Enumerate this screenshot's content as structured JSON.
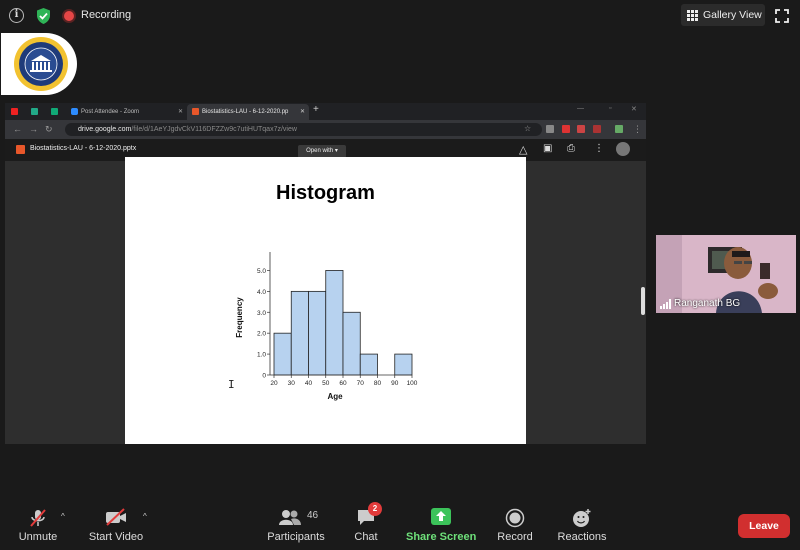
{
  "topbar": {
    "recording_label": "Recording",
    "gallery_view_label": "Gallery View"
  },
  "browser": {
    "tabs": [
      {
        "label": ""
      },
      {
        "label": ""
      },
      {
        "label": ""
      },
      {
        "label": "Post Attendee - Zoom"
      },
      {
        "label": "Biostatistics-LAU - 6-12-2020.pp"
      }
    ],
    "url_host": "drive.google.com",
    "url_rest": "/file/d/1AeYJgdvCkV116DFZZw9c7utiHUTqax7z/view",
    "file_title": "Biostatistics-LAU - 6-12-2020.pptx",
    "open_with_label": "Open with"
  },
  "slide": {
    "title": "Histogram"
  },
  "chart_data": {
    "type": "bar",
    "title": "Histogram",
    "xlabel": "Age",
    "ylabel": "Frequency",
    "bin_edges": [
      20,
      30,
      40,
      50,
      60,
      70,
      80,
      90,
      100
    ],
    "x_ticks": [
      "20",
      "30",
      "40",
      "50",
      "60",
      "70",
      "80",
      "90",
      "100"
    ],
    "y_ticks": [
      "0",
      "1.0",
      "2.0",
      "3.0",
      "4.0",
      "5.0"
    ],
    "values": [
      2,
      4,
      4,
      5,
      3,
      1,
      0,
      1
    ],
    "ylim": [
      0,
      5.5
    ],
    "xlim": [
      20,
      100
    ],
    "bar_color": "#b7d2ef",
    "grid": false
  },
  "participant": {
    "name": "Ranganath BG"
  },
  "toolbar": {
    "unmute_label": "Unmute",
    "start_video_label": "Start Video",
    "participants_label": "Participants",
    "participants_count": "46",
    "chat_label": "Chat",
    "chat_badge": "2",
    "share_screen_label": "Share Screen",
    "record_label": "Record",
    "reactions_label": "Reactions",
    "leave_label": "Leave"
  },
  "colors": {
    "share_green": "#3cc35a",
    "leave_red": "#d12f2f",
    "recording_red": "#e54646"
  }
}
